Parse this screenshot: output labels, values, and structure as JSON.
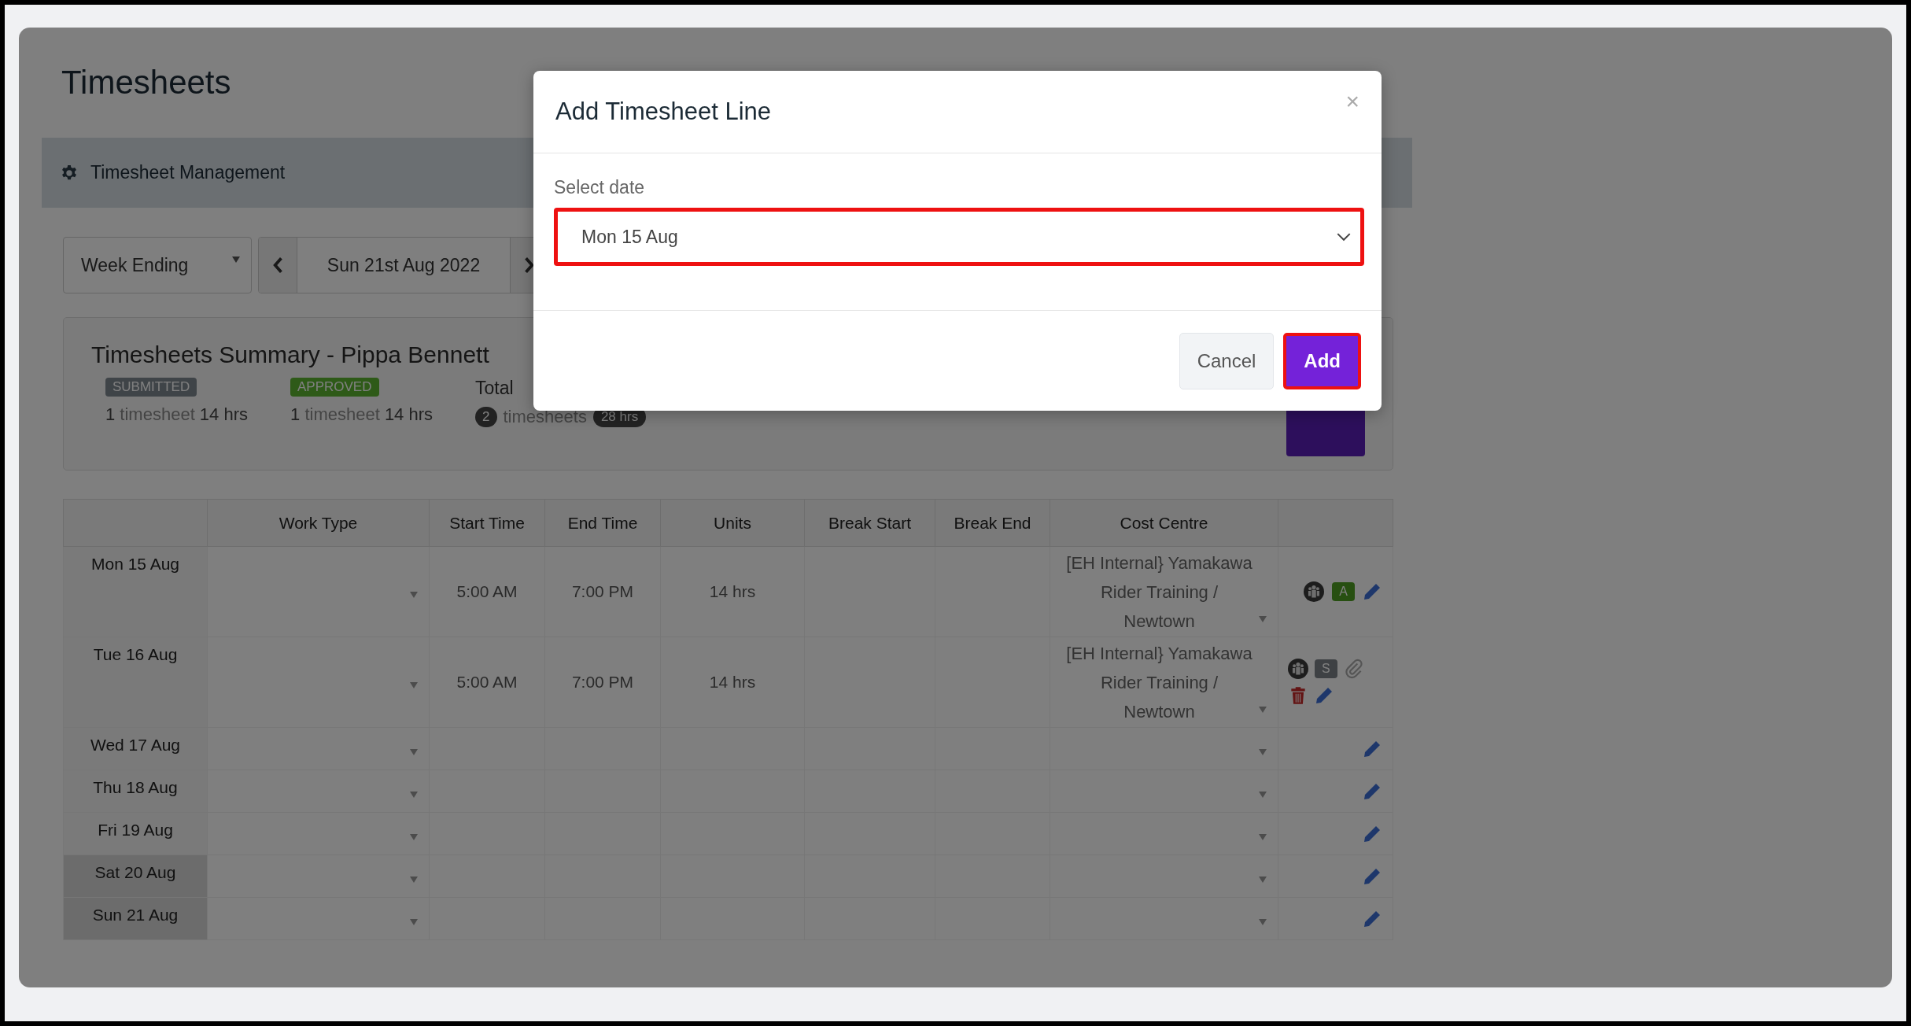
{
  "page": {
    "title": "Timesheets"
  },
  "management_bar": {
    "title": "Timesheet Management"
  },
  "filters": {
    "period": "Week Ending",
    "date": "Sun 21st Aug 2022"
  },
  "summary": {
    "title": "Timesheets Summary - Pippa Bennett",
    "groups": [
      {
        "badge": "SUBMITTED",
        "kind": "submitted",
        "count": "1",
        "unit": "timesheet",
        "hours": "14 hrs"
      },
      {
        "badge": "APPROVED",
        "kind": "approved",
        "count": "1",
        "unit": "timesheet",
        "hours": "14 hrs"
      }
    ],
    "total": {
      "label": "Total",
      "count": "2",
      "unit": "timesheets",
      "hours": "28 hrs"
    }
  },
  "table": {
    "columns": [
      "Work Type",
      "Start Time",
      "End Time",
      "Units",
      "Break Start",
      "Break End",
      "Cost Centre"
    ],
    "rows": [
      {
        "date": "Mon 15 Aug",
        "weekend": false,
        "start": "5:00 AM",
        "end": "7:00 PM",
        "units": "14 hrs",
        "cost_centre": "[EH Internal} Yamakawa Rider Training / Newtown",
        "status": {
          "label": "A",
          "kind": "approved"
        },
        "attachment": false,
        "deletable": false
      },
      {
        "date": "Tue 16 Aug",
        "weekend": false,
        "start": "5:00 AM",
        "end": "7:00 PM",
        "units": "14 hrs",
        "cost_centre": "[EH Internal} Yamakawa Rider Training / Newtown",
        "status": {
          "label": "S",
          "kind": "submitted"
        },
        "attachment": true,
        "deletable": true
      },
      {
        "date": "Wed 17 Aug",
        "weekend": false,
        "attachment": false,
        "deletable": false
      },
      {
        "date": "Thu 18 Aug",
        "weekend": false,
        "attachment": false,
        "deletable": false
      },
      {
        "date": "Fri 19 Aug",
        "weekend": false,
        "attachment": false,
        "deletable": false
      },
      {
        "date": "Sat 20 Aug",
        "weekend": true,
        "attachment": false,
        "deletable": false
      },
      {
        "date": "Sun 21 Aug",
        "weekend": true,
        "attachment": false,
        "deletable": false
      }
    ]
  },
  "modal": {
    "title": "Add Timesheet Line",
    "close": "×",
    "field_label": "Select date",
    "field_value": "Mon 15 Aug",
    "field_highlighted": true,
    "buttons": [
      {
        "label": "Cancel",
        "kind": "secondary",
        "highlighted": false
      },
      {
        "label": "Add",
        "kind": "primary",
        "highlighted": true
      }
    ]
  }
}
